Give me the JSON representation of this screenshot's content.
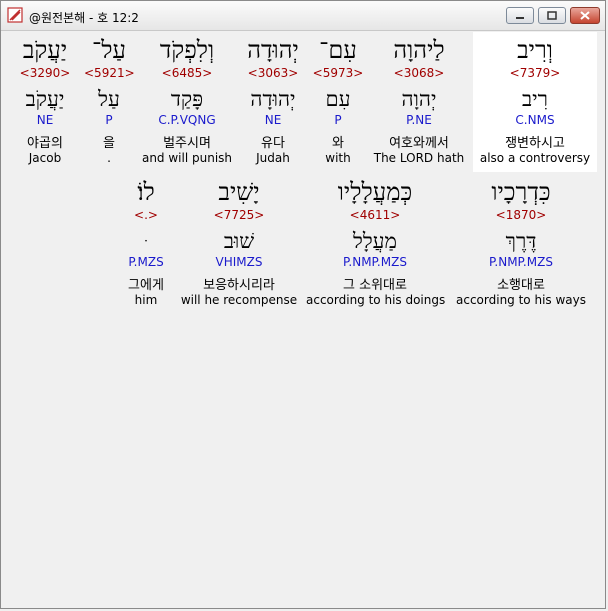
{
  "window": {
    "title": "@원전본해 - 호 12:2"
  },
  "verse_rows": [
    [
      {
        "hebrew": "וְרִיב",
        "strong": "<7379>",
        "lemma": "רִיב",
        "morph": "C.NMS",
        "korean": "쟁변하시고",
        "english": "also a controversy"
      },
      {
        "hebrew": "לַיהוָה",
        "strong": "<3068>",
        "lemma": "יְהוָה",
        "morph": "P.NE",
        "korean": "여호와께서",
        "english": "The LORD hath"
      },
      {
        "hebrew": "עִם־",
        "strong": "<5973>",
        "lemma": "עִם",
        "morph": "P",
        "korean": "와",
        "english": "with"
      },
      {
        "hebrew": "יְהוּדָה",
        "strong": "<3063>",
        "lemma": "יְהוּדָה",
        "morph": "NE",
        "korean": "유다",
        "english": "Judah"
      },
      {
        "hebrew": "וְלִפְקֹד",
        "strong": "<6485>",
        "lemma": "פָּקַד",
        "morph": "C.P.VQNG",
        "korean": "벌주시며",
        "english": "and will punish"
      },
      {
        "hebrew": "עַל־",
        "strong": "<5921>",
        "lemma": "עַל",
        "morph": "P",
        "korean": "을",
        "english": "."
      },
      {
        "hebrew": "יַעֲקֹב",
        "strong": "<3290>",
        "lemma": "יַעֲקֹב",
        "morph": "NE",
        "korean": "야곱의",
        "english": "Jacob"
      }
    ],
    [
      {
        "hebrew": "כִּדְרָכָיו",
        "strong": "<1870>",
        "lemma": "דֶּרֶךְ",
        "morph": "P.NMP.MZS",
        "korean": "소행대로",
        "english": "according to his ways"
      },
      {
        "hebrew": "כְּמַעֲלָלָיו",
        "strong": "<4611>",
        "lemma": "מַעֲלָל",
        "morph": "P.NMP.MZS",
        "korean": "그 소위대로",
        "english": "according to his doings"
      },
      {
        "hebrew": "יָשִׁיב",
        "strong": "<7725>",
        "lemma": "שׁוּב",
        "morph": "VHIMZS",
        "korean": "보응하시리라",
        "english": "will he recompense"
      },
      {
        "hebrew": "לוֹ׃",
        "strong": "<.>",
        "lemma": "ּ",
        "morph": "P.MZS",
        "korean": "그에게",
        "english": "him"
      }
    ]
  ]
}
